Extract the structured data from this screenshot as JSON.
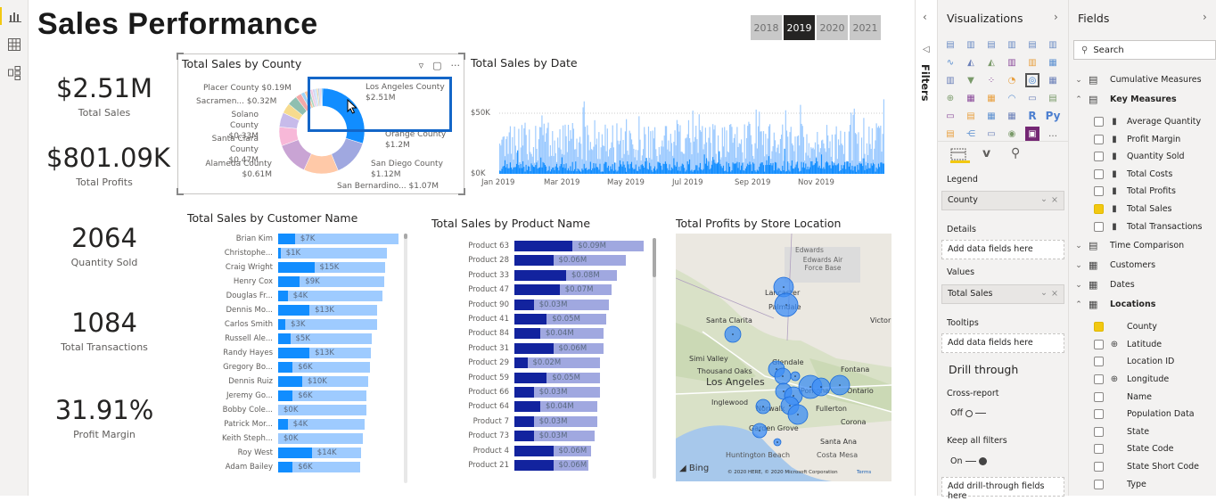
{
  "leftnav": {
    "items": [
      {
        "name": "report-view",
        "icon": "bar-chart-icon"
      },
      {
        "name": "data-view",
        "icon": "table-icon"
      },
      {
        "name": "model-view",
        "icon": "model-icon"
      }
    ]
  },
  "page": {
    "title": "Sales Performance"
  },
  "year_slicer": {
    "options": [
      "2018",
      "2019",
      "2020",
      "2021"
    ],
    "selected": "2019"
  },
  "kpis": [
    {
      "value": "$2.51M",
      "label": "Total Sales"
    },
    {
      "value": "$801.09K",
      "label": "Total Profits"
    },
    {
      "value": "2064",
      "label": "Quantity Sold"
    },
    {
      "value": "1084",
      "label": "Total Transactions"
    },
    {
      "value": "31.91%",
      "label": "Profit Margin"
    }
  ],
  "donut": {
    "title": "Total Sales by County",
    "labels": [
      {
        "name": "Los Angeles County",
        "value": "$2.51M"
      },
      {
        "name": "Orange County",
        "value": "$1.2M"
      },
      {
        "name": "San Diego County",
        "value": "$1.12M"
      },
      {
        "name": "San Bernardino...",
        "value": "$1.07M"
      },
      {
        "name": "Alameda County",
        "value": "$0.61M"
      },
      {
        "name": "Santa Clara County",
        "value": "$0.47M"
      },
      {
        "name": "Solano County",
        "value": "$0.33M"
      },
      {
        "name": "Sacramen...",
        "value": "$0.32M"
      },
      {
        "name": "Placer County",
        "value": "$0.19M"
      }
    ]
  },
  "chart_data": [
    {
      "type": "pie",
      "title": "Total Sales by County",
      "categories": [
        "Los Angeles County",
        "Orange County",
        "San Diego County",
        "San Bernardino...",
        "Alameda County",
        "Santa Clara County",
        "Solano County",
        "Sacramen...",
        "Placer County"
      ],
      "values": [
        2.51,
        1.2,
        1.12,
        1.07,
        0.61,
        0.47,
        0.33,
        0.32,
        0.19
      ],
      "unit": "$M",
      "legend": "none"
    },
    {
      "type": "bar",
      "title": "Total Sales by Date",
      "x_ticks": [
        "Jan 2019",
        "Mar 2019",
        "May 2019",
        "Jul 2019",
        "Sep 2019",
        "Nov 2019"
      ],
      "y_ticks": [
        "$0K",
        "$50K"
      ],
      "ylim": [
        0,
        70000
      ],
      "grid": true
    },
    {
      "type": "bar",
      "title": "Total Sales by Customer Name",
      "categories": [
        "Brian Kim",
        "Christophe...",
        "Craig Wright",
        "Henry Cox",
        "Douglas Fr...",
        "Dennis Mo...",
        "Carlos Smith",
        "Russell Ale...",
        "Randy Hayes",
        "Gregory Bo...",
        "Dennis Ruiz",
        "Jeremy Go...",
        "Bobby Cole...",
        "Patrick Mor...",
        "Keith Steph...",
        "Roy West",
        "Adam Bailey"
      ],
      "values": [
        7,
        1,
        15,
        9,
        4,
        13,
        3,
        5,
        13,
        6,
        10,
        6,
        0,
        4,
        0,
        14,
        6
      ],
      "labels": [
        "$7K",
        "$1K",
        "$15K",
        "$9K",
        "$4K",
        "$13K",
        "$3K",
        "$5K",
        "$13K",
        "$6K",
        "$10K",
        "$6K",
        "$0K",
        "$4K",
        "$0K",
        "$14K",
        "$6K"
      ],
      "background_totals_rel": [
        1.0,
        0.9,
        0.89,
        0.88,
        0.87,
        0.82,
        0.82,
        0.78,
        0.77,
        0.76,
        0.75,
        0.73,
        0.73,
        0.72,
        0.7,
        0.69,
        0.68
      ],
      "unit": "$K"
    },
    {
      "type": "bar",
      "title": "Total Sales by Product Name",
      "categories": [
        "Product 63",
        "Product 28",
        "Product 33",
        "Product 47",
        "Product 90",
        "Product 41",
        "Product 84",
        "Product 31",
        "Product 29",
        "Product 59",
        "Product 66",
        "Product 64",
        "Product 7",
        "Product 73",
        "Product 4",
        "Product 21"
      ],
      "values": [
        0.09,
        0.06,
        0.08,
        0.07,
        0.03,
        0.05,
        0.04,
        0.06,
        0.02,
        0.05,
        0.03,
        0.04,
        0.03,
        0.03,
        0.06,
        0.06
      ],
      "labels": [
        "$0.09M",
        "$0.06M",
        "$0.08M",
        "$0.07M",
        "$0.03M",
        "$0.05M",
        "$0.04M",
        "$0.06M",
        "$0.02M",
        "$0.05M",
        "$0.03M",
        "$0.04M",
        "$0.03M",
        "$0.03M",
        "$0.06M",
        "$0.06M"
      ],
      "background_totals_rel": [
        1.0,
        0.86,
        0.79,
        0.75,
        0.73,
        0.71,
        0.69,
        0.69,
        0.66,
        0.66,
        0.66,
        0.64,
        0.64,
        0.62,
        0.59,
        0.57
      ],
      "unit": "$M"
    }
  ],
  "timeline": {
    "title": "Total Sales by Date",
    "y_ticks": [
      "$50K",
      "$0K"
    ],
    "x_ticks": [
      "Jan 2019",
      "Mar 2019",
      "May 2019",
      "Jul 2019",
      "Sep 2019",
      "Nov 2019"
    ]
  },
  "customers": {
    "title": "Total Sales by Customer Name"
  },
  "products": {
    "title": "Total Sales by Product Name"
  },
  "map": {
    "title": "Total Profits by Store Location",
    "places": [
      "Edwards",
      "Edwards Air Force Base",
      "Lancaster",
      "Palmdale",
      "Santa Clarita",
      "Victor",
      "Simi Valley",
      "Glendale",
      "Thousand Oaks",
      "Los Angeles",
      "Fontana",
      "Ontario",
      "Inglewood",
      "Norwalk",
      "Pomona",
      "Fullerton",
      "Corona",
      "Garden Grove",
      "Santa Ana",
      "Huntington Beach",
      "Costa Mesa"
    ],
    "attribution": "© 2020 HERE, © 2020 Microsoft Corporation",
    "terms": "Terms",
    "provider": "Bing"
  },
  "colors": {
    "accent": "#118dff",
    "light_blue": "#9ecbff",
    "navy": "#12239e",
    "lavender": "#a0a8e0",
    "yellow": "#f2c811"
  },
  "filters_pane": {
    "label": "Filters"
  },
  "viz_pane": {
    "title": "Visualizations",
    "legend_label": "Legend",
    "legend_value": "County",
    "details_label": "Details",
    "details_placeholder": "Add data fields here",
    "values_label": "Values",
    "values_value": "Total Sales",
    "tooltips_label": "Tooltips",
    "tooltips_placeholder": "Add data fields here",
    "drill_title": "Drill through",
    "cross_report_label": "Cross-report",
    "cross_report_state": "Off",
    "keep_filters_label": "Keep all filters",
    "keep_filters_state": "On",
    "drill_placeholder": "Add drill-through fields here"
  },
  "fields_pane": {
    "title": "Fields",
    "search_placeholder": "Search",
    "groups": [
      {
        "name": "Cumulative Measures",
        "expanded": false,
        "type": "measure"
      },
      {
        "name": "Key Measures",
        "expanded": true,
        "type": "measure",
        "items": [
          {
            "name": "Average Quantity",
            "checked": false
          },
          {
            "name": "Profit Margin",
            "checked": false
          },
          {
            "name": "Quantity Sold",
            "checked": false
          },
          {
            "name": "Total Costs",
            "checked": false
          },
          {
            "name": "Total Profits",
            "checked": false
          },
          {
            "name": "Total Sales",
            "checked": true
          },
          {
            "name": "Total Transactions",
            "checked": false
          }
        ]
      },
      {
        "name": "Time Comparison",
        "expanded": false,
        "type": "measure"
      },
      {
        "name": "Customers",
        "expanded": false,
        "type": "table"
      },
      {
        "name": "Dates",
        "expanded": false,
        "type": "table"
      },
      {
        "name": "Locations",
        "expanded": true,
        "type": "table",
        "items": [
          {
            "name": "County",
            "checked": true
          },
          {
            "name": "Latitude",
            "checked": false,
            "geo": true
          },
          {
            "name": "Location ID",
            "checked": false
          },
          {
            "name": "Longitude",
            "checked": false,
            "geo": true
          },
          {
            "name": "Name",
            "checked": false
          },
          {
            "name": "Population Data",
            "checked": false
          },
          {
            "name": "State",
            "checked": false
          },
          {
            "name": "State Code",
            "checked": false
          },
          {
            "name": "State Short Code",
            "checked": false
          },
          {
            "name": "Type",
            "checked": false
          }
        ]
      }
    ]
  }
}
